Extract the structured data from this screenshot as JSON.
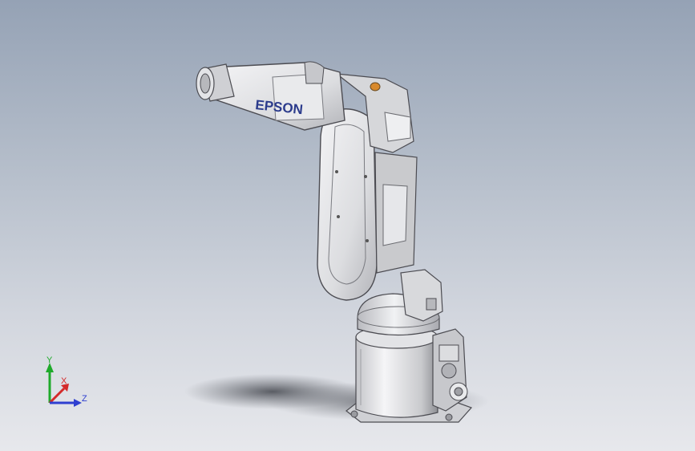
{
  "model": {
    "brand_label": "EPSON"
  },
  "triad": {
    "y_label": "Y",
    "x_label": "X",
    "z_label": "Z"
  },
  "colors": {
    "background_top": "#95a2b5",
    "background_bottom": "#e7e8ec",
    "robot_body": "#e6e7ea",
    "robot_edge": "#4c4c52",
    "brand_text": "#2b3b8c",
    "axis_y": "#1faa2b",
    "axis_x": "#d42a2a",
    "axis_z": "#2e3fd0"
  }
}
